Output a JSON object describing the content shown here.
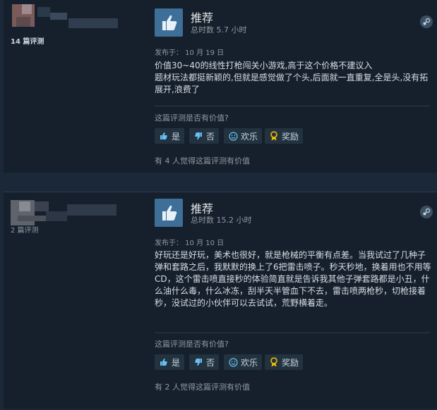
{
  "reviews": [
    {
      "review_count_label": "14 篇评测",
      "recommendation": "推荐",
      "hours": "总时数 5.7 小时",
      "posted": "发布于： 10 月 19 日",
      "text": "价值30~40的线性打枪闯关小游戏,高于这个价格不建议入\n题材玩法都挺新颖的,但就是感觉做了个头,后面就一直重复,全是头,没有拓展开,浪费了",
      "helpful_question": "这篇评测是否有价值?",
      "buttons": {
        "yes": "是",
        "no": "否",
        "funny": "欢乐",
        "award": "奖励"
      },
      "found_helpful": "有 4 人觉得这篇评测有价值"
    },
    {
      "review_count_label": "2 篇评测",
      "recommendation": "推荐",
      "hours": "总时数 15.2 小时",
      "posted": "发布于： 10 月 10 日",
      "text": "好玩还是好玩，美术也很好，就是枪械的平衡有点差。当我试过了几种子弹和套路之后，我默默的换上了6把雷击喷子。秒天秒地，换着用也不用等CD，这个雷击喷直接秒的体验简直就是告诉我其他子弹套路都是小丑，什么油什么毒，什么冰冻，刮半天半管血下不去，雷击喷两枪秒，切枪接着秒，没试过的小伙伴可以去试试，荒野横着走。",
      "helpful_question": "这篇评测是否有价值?",
      "buttons": {
        "yes": "是",
        "no": "否",
        "funny": "欢乐",
        "award": "奖励"
      },
      "found_helpful": "有 2 人觉得这篇评测有价值"
    }
  ],
  "colors": {
    "page_bg": "#1b2838",
    "card_bg": "#16202d",
    "thumb_bg": "#3d6f98",
    "award": "#f0c000"
  },
  "icons": [
    "thumbs-up-icon",
    "steam-icon",
    "thumb-up-small-icon",
    "thumb-down-small-icon",
    "smile-icon",
    "award-icon"
  ]
}
